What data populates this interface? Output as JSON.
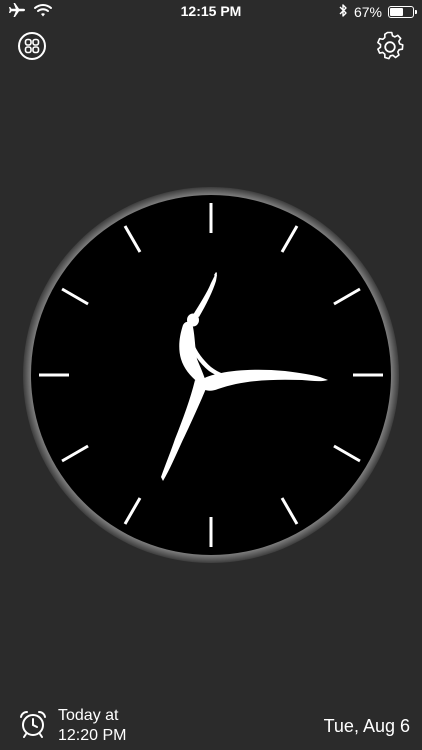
{
  "status_bar": {
    "time": "12:15 PM",
    "battery_percent": "67%",
    "battery_level": 0.67,
    "icons": [
      "airplane-icon",
      "wifi-icon",
      "bluetooth-icon",
      "battery-icon"
    ]
  },
  "toolbar": {
    "left_icon": "grid-menu-icon",
    "right_icon": "gear-icon"
  },
  "clock": {
    "hour": 12,
    "minute": 15,
    "hand_style": "dancer-silhouette",
    "face_color": "#000000",
    "bezel_color": "#5a5a5a",
    "tick_color": "#ffffff",
    "hand_color": "#ffffff"
  },
  "alarm": {
    "icon": "alarm-clock-icon",
    "line1": "Today at",
    "line2": "12:20 PM"
  },
  "date": {
    "text": "Tue, Aug 6"
  }
}
